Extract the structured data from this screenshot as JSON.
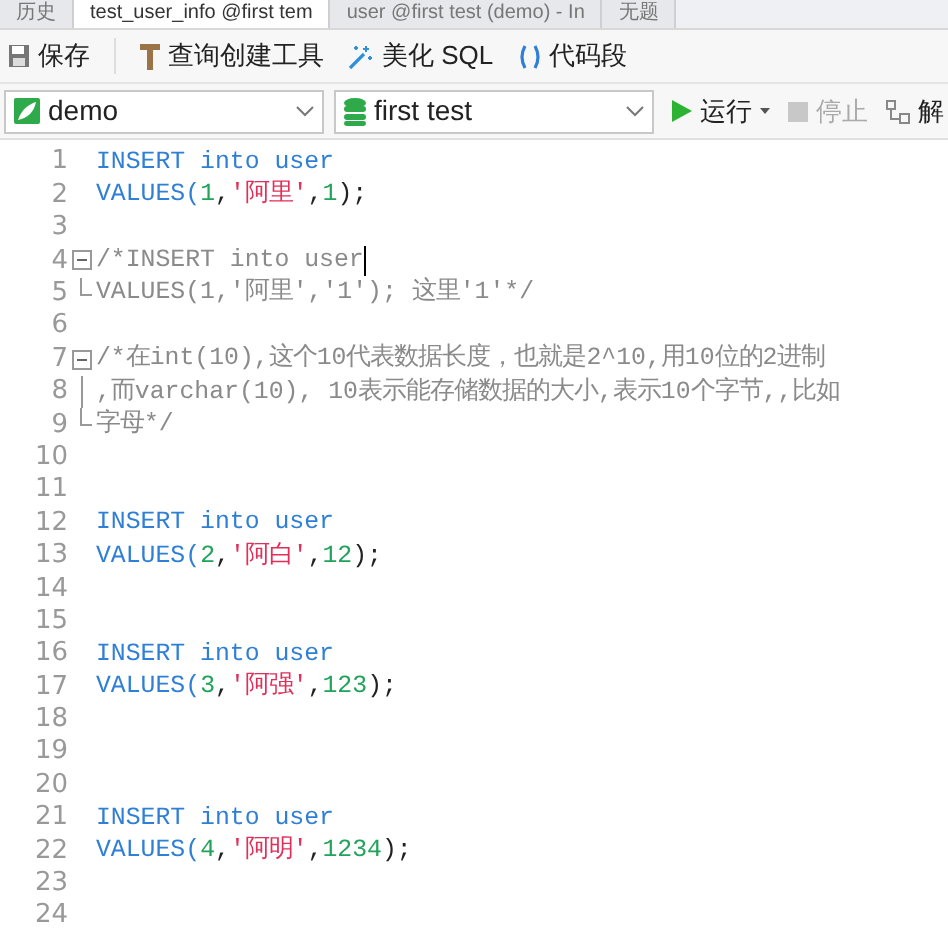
{
  "tabs": [
    {
      "label": "历史",
      "selected": false
    },
    {
      "label": "test_user_info @first tem",
      "selected": true
    },
    {
      "label": "user @first test (demo) - In",
      "selected": false
    },
    {
      "label": "无题",
      "selected": false
    }
  ],
  "toolbar": [
    {
      "kind": "save",
      "label": "保存"
    },
    {
      "kind": "builder",
      "label": "查询创建工具"
    },
    {
      "kind": "beautify",
      "label": "美化 SQL"
    },
    {
      "kind": "snippet",
      "label": "代码段"
    }
  ],
  "connection": {
    "value": "demo"
  },
  "database": {
    "value": "first test"
  },
  "actions": [
    {
      "kind": "run",
      "label": "运行",
      "disabled": false
    },
    {
      "kind": "stop",
      "label": "停止",
      "disabled": true
    },
    {
      "kind": "explain",
      "label": "解",
      "disabled": false
    }
  ],
  "lines": [
    {
      "number": "1",
      "kind": "plain",
      "caret": false,
      "tokens": [
        {
          "kind": "kw",
          "text": "INSERT into user"
        }
      ]
    },
    {
      "number": "2",
      "kind": "plain",
      "caret": false,
      "tokens": [
        {
          "kind": "kw",
          "text": "VALUES("
        },
        {
          "kind": "num",
          "text": "1"
        },
        {
          "kind": "plain",
          "text": ","
        },
        {
          "kind": "str",
          "text": "'阿里'"
        },
        {
          "kind": "plain",
          "text": ","
        },
        {
          "kind": "num",
          "text": "1"
        },
        {
          "kind": "plain",
          "text": ");"
        }
      ]
    },
    {
      "number": "3",
      "kind": "plain",
      "caret": false
    },
    {
      "number": "4",
      "kind": "fold_start",
      "caret": true,
      "tokens": [
        {
          "kind": "comment",
          "text": "/*INSERT into user"
        }
      ]
    },
    {
      "number": "5",
      "kind": "fold_end",
      "caret": false,
      "tokens": [
        {
          "kind": "comment",
          "text": "VALUES(1,'阿里','1');        这里'1'*/"
        }
      ]
    },
    {
      "number": "6",
      "kind": "plain",
      "caret": false
    },
    {
      "number": "7",
      "kind": "fold_start",
      "caret": false,
      "tokens": [
        {
          "kind": "comment",
          "text": "/*在int(10),这个10代表数据长度，也就是2^10,用10位的2进制"
        }
      ]
    },
    {
      "number": "8",
      "kind": "fold_mid",
      "caret": false,
      "tokens": [
        {
          "kind": "comment",
          "text": ",而varchar(10), 10表示能存储数据的大小,表示10个字节,,比如"
        }
      ]
    },
    {
      "number": "9",
      "kind": "fold_end",
      "caret": false,
      "tokens": [
        {
          "kind": "comment",
          "text": "字母*/"
        }
      ]
    },
    {
      "number": "10",
      "kind": "plain",
      "caret": false
    },
    {
      "number": "11",
      "kind": "plain",
      "caret": false
    },
    {
      "number": "12",
      "kind": "plain",
      "caret": false,
      "tokens": [
        {
          "kind": "kw",
          "text": "INSERT into user"
        }
      ]
    },
    {
      "number": "13",
      "kind": "plain",
      "caret": false,
      "tokens": [
        {
          "kind": "kw",
          "text": "VALUES("
        },
        {
          "kind": "num",
          "text": "2"
        },
        {
          "kind": "plain",
          "text": ","
        },
        {
          "kind": "str",
          "text": "'阿白'"
        },
        {
          "kind": "plain",
          "text": ","
        },
        {
          "kind": "num",
          "text": "12"
        },
        {
          "kind": "plain",
          "text": ");"
        }
      ]
    },
    {
      "number": "14",
      "kind": "plain",
      "caret": false
    },
    {
      "number": "15",
      "kind": "plain",
      "caret": false
    },
    {
      "number": "16",
      "kind": "plain",
      "caret": false,
      "tokens": [
        {
          "kind": "kw",
          "text": "INSERT into user"
        }
      ]
    },
    {
      "number": "17",
      "kind": "plain",
      "caret": false,
      "tokens": [
        {
          "kind": "kw",
          "text": "VALUES("
        },
        {
          "kind": "num",
          "text": "3"
        },
        {
          "kind": "plain",
          "text": ","
        },
        {
          "kind": "str",
          "text": "'阿强'"
        },
        {
          "kind": "plain",
          "text": ","
        },
        {
          "kind": "num",
          "text": "123"
        },
        {
          "kind": "plain",
          "text": ");"
        }
      ]
    },
    {
      "number": "18",
      "kind": "plain",
      "caret": false
    },
    {
      "number": "19",
      "kind": "plain",
      "caret": false
    },
    {
      "number": "20",
      "kind": "plain",
      "caret": false
    },
    {
      "number": "21",
      "kind": "plain",
      "caret": false,
      "tokens": [
        {
          "kind": "kw",
          "text": "INSERT into user"
        }
      ]
    },
    {
      "number": "22",
      "kind": "plain",
      "caret": false,
      "tokens": [
        {
          "kind": "kw",
          "text": "VALUES("
        },
        {
          "kind": "num",
          "text": "4"
        },
        {
          "kind": "plain",
          "text": ","
        },
        {
          "kind": "str",
          "text": "'阿明'"
        },
        {
          "kind": "plain",
          "text": ","
        },
        {
          "kind": "num",
          "text": "1234"
        },
        {
          "kind": "plain",
          "text": ");"
        }
      ]
    },
    {
      "number": "23",
      "kind": "plain",
      "caret": false
    },
    {
      "number": "24",
      "kind": "plain",
      "caret": false
    }
  ]
}
